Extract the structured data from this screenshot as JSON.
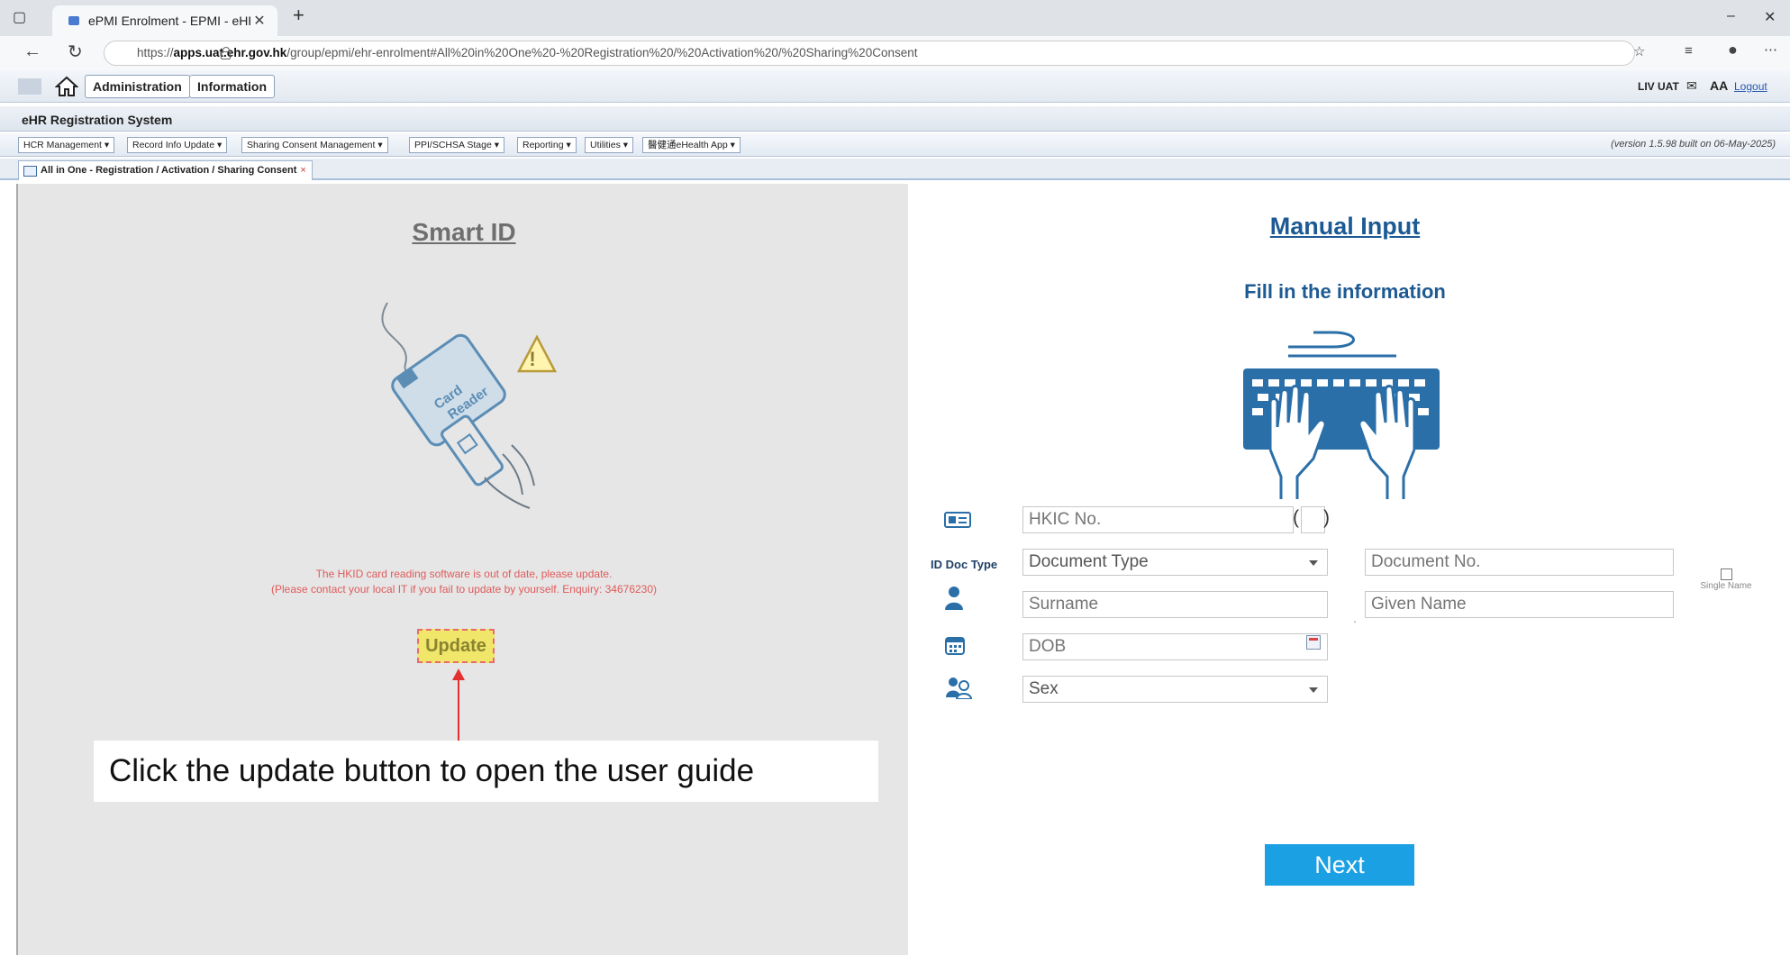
{
  "browser": {
    "tab_title": "ePMI Enrolment - EPMI - eHR",
    "url_prefix": "https://",
    "url_host": "apps.uat.ehr.gov.hk",
    "url_rest": "/group/epmi/ehr-enrolment#All%20in%20One%20-%20Registration%20/%20Activation%20/%20Sharing%20Consent"
  },
  "header": {
    "administration": "Administration",
    "information": "Information",
    "env": "LIV UAT",
    "font_size": "AA",
    "logout": "Logout"
  },
  "system_title": "eHR Registration System",
  "menu": [
    "HCR Management ▾",
    "Record Info Update ▾",
    "Sharing Consent Management ▾",
    "PPI/SCHSA Stage ▾",
    "Reporting ▾",
    "Utilities ▾",
    "醫健通eHealth App ▾"
  ],
  "version": "(version 1.5.98 built on 06-May-2025)",
  "app_tab": "All in One - Registration / Activation / Sharing Consent",
  "smart_id": {
    "title": "Smart ID",
    "reader_text_1": "Card",
    "reader_text_2": "Reader",
    "error_line1": "The HKID card reading software is out of date, please update.",
    "error_line2": "(Please contact your local IT if you fail to update by yourself. Enquiry: 34676230)",
    "update_label": "Update",
    "callout": "Click the update button to open the user guide"
  },
  "manual": {
    "title": "Manual Input",
    "subtitle": "Fill in the information",
    "hkic_placeholder": "HKIC No.",
    "id_doc_type_label": "ID Doc Type",
    "doc_type": "Document Type",
    "doc_no_placeholder": "Document No.",
    "surname_placeholder": "Surname",
    "given_name_placeholder": "Given Name",
    "single_name": "Single Name",
    "dob_placeholder": "DOB",
    "sex": "Sex",
    "next_label": "Next"
  },
  "colors": {
    "accent": "#1d5a93",
    "next_button": "#1ba0e3",
    "error": "#e05a5a",
    "update_button": "#efe66a"
  }
}
